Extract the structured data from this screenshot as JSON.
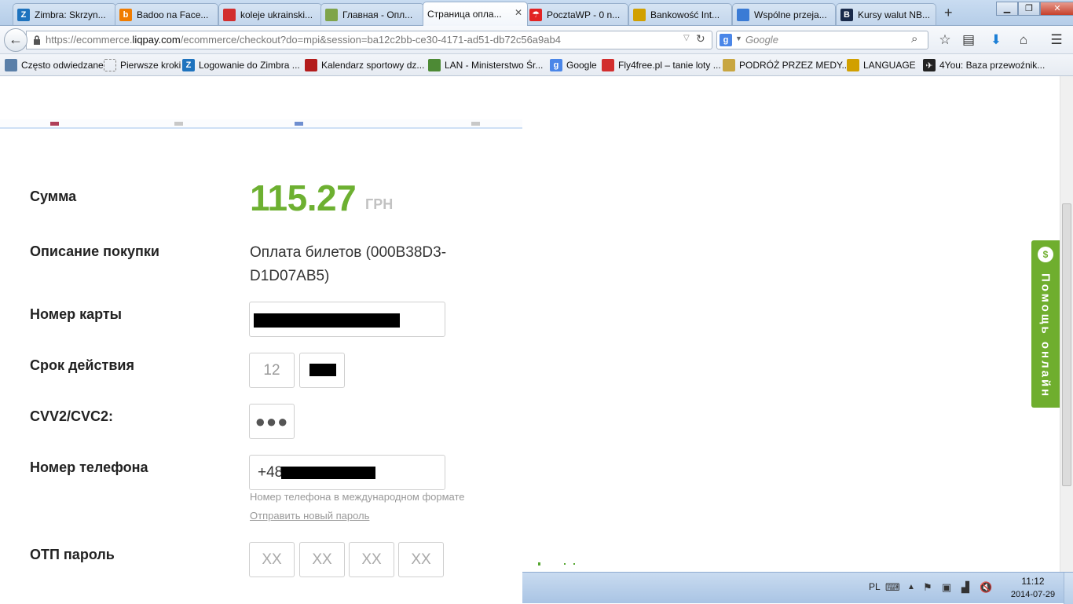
{
  "tabs": [
    {
      "label": "Zimbra: Skrzyn...",
      "icon": "zimbra-icon",
      "color": "#1e73be",
      "glyph": "Z"
    },
    {
      "label": "Badoo na Face...",
      "icon": "badoo-icon",
      "color": "#f07c00",
      "glyph": "b"
    },
    {
      "label": "koleje ukrainski...",
      "icon": "flight-icon",
      "color": "#d22e2e",
      "glyph": ""
    },
    {
      "label": "Главная - Опл...",
      "icon": "uz-icon",
      "color": "#7fa44a",
      "glyph": ""
    },
    {
      "label": "Страница опла...",
      "icon": "",
      "color": "",
      "glyph": "",
      "active": true
    },
    {
      "label": "PocztaWP - 0 n...",
      "icon": "wp-icon",
      "color": "#e22323",
      "glyph": "☂"
    },
    {
      "label": "Bankowość Int...",
      "icon": "bank-icon",
      "color": "#d1a000",
      "glyph": ""
    },
    {
      "label": "Wspólne przeja...",
      "icon": "people-icon",
      "color": "#3a7bd5",
      "glyph": ""
    },
    {
      "label": "Kursy walut NB...",
      "icon": "nbp-icon",
      "color": "#1a2a4a",
      "glyph": "B"
    }
  ],
  "url": {
    "prefix": "https://ecommerce.",
    "host": "liqpay.com",
    "path": "/ecommerce/checkout?do=mpi&session=ba12c2bb-ce30-4171-ad51-db72c56a9ab4"
  },
  "search": {
    "placeholder": "Google"
  },
  "bookmarks": [
    {
      "label": "Często odwiedzane",
      "icon": "bookmark-folder-icon",
      "color": "#5a7fa8",
      "glyph": ""
    },
    {
      "label": "Pierwsze kroki",
      "icon": "page-icon",
      "color": "",
      "glyph": ""
    },
    {
      "label": "Logowanie do Zimbra ...",
      "icon": "zimbra-icon",
      "color": "#1e73be",
      "glyph": "Z"
    },
    {
      "label": "Kalendarz sportowy dz...",
      "icon": "calendar-icon",
      "color": "#b31b1b",
      "glyph": ""
    },
    {
      "label": "LAN - Ministerstwo Śr...",
      "icon": "lan-icon",
      "color": "#4d8a35",
      "glyph": ""
    },
    {
      "label": "Google",
      "icon": "google-icon",
      "color": "#4a86e8",
      "glyph": "g"
    },
    {
      "label": "Fly4free.pl – tanie loty ...",
      "icon": "flight-icon",
      "color": "#d22e2e",
      "glyph": ""
    },
    {
      "label": "PODRÓŻ PRZEZ MEDY...",
      "icon": "emblem-icon",
      "color": "#c8a640",
      "glyph": ""
    },
    {
      "label": "LANGUAGE",
      "icon": "language-icon",
      "color": "#d1a000",
      "glyph": ""
    },
    {
      "label": "4You: Baza przewoźnik...",
      "icon": "plane-icon",
      "color": "#222222",
      "glyph": "✈"
    }
  ],
  "form": {
    "amount_label": "Сумма",
    "amount_value": "115.27",
    "amount_currency": "ГРН",
    "description_label": "Описание покупки",
    "description_value": "Оплата билетов (000B38D3-D1D07AB5)",
    "card_label": "Номер карты",
    "expiry_label": "Срок действия",
    "expiry_month": "12",
    "cvv_label": "CVV2/CVC2:",
    "cvv_value": "●●●",
    "phone_label": "Номер телефона",
    "phone_prefix": "+48",
    "phone_hint": "Номер телефона в международном формате",
    "resend_link": "Отправить новый пароль",
    "otp_label": "ОТП пароль",
    "otp_placeholders": [
      "XX",
      "XX",
      "XX",
      "XX"
    ]
  },
  "help_widget": {
    "label": "Помощь онлайн",
    "icon_glyph": "$"
  },
  "taskbar": {
    "language": "PL",
    "time": "11:12",
    "date": "2014-07-29"
  },
  "colors": {
    "amount_green": "#6db031",
    "help_green": "#6fae2e"
  }
}
